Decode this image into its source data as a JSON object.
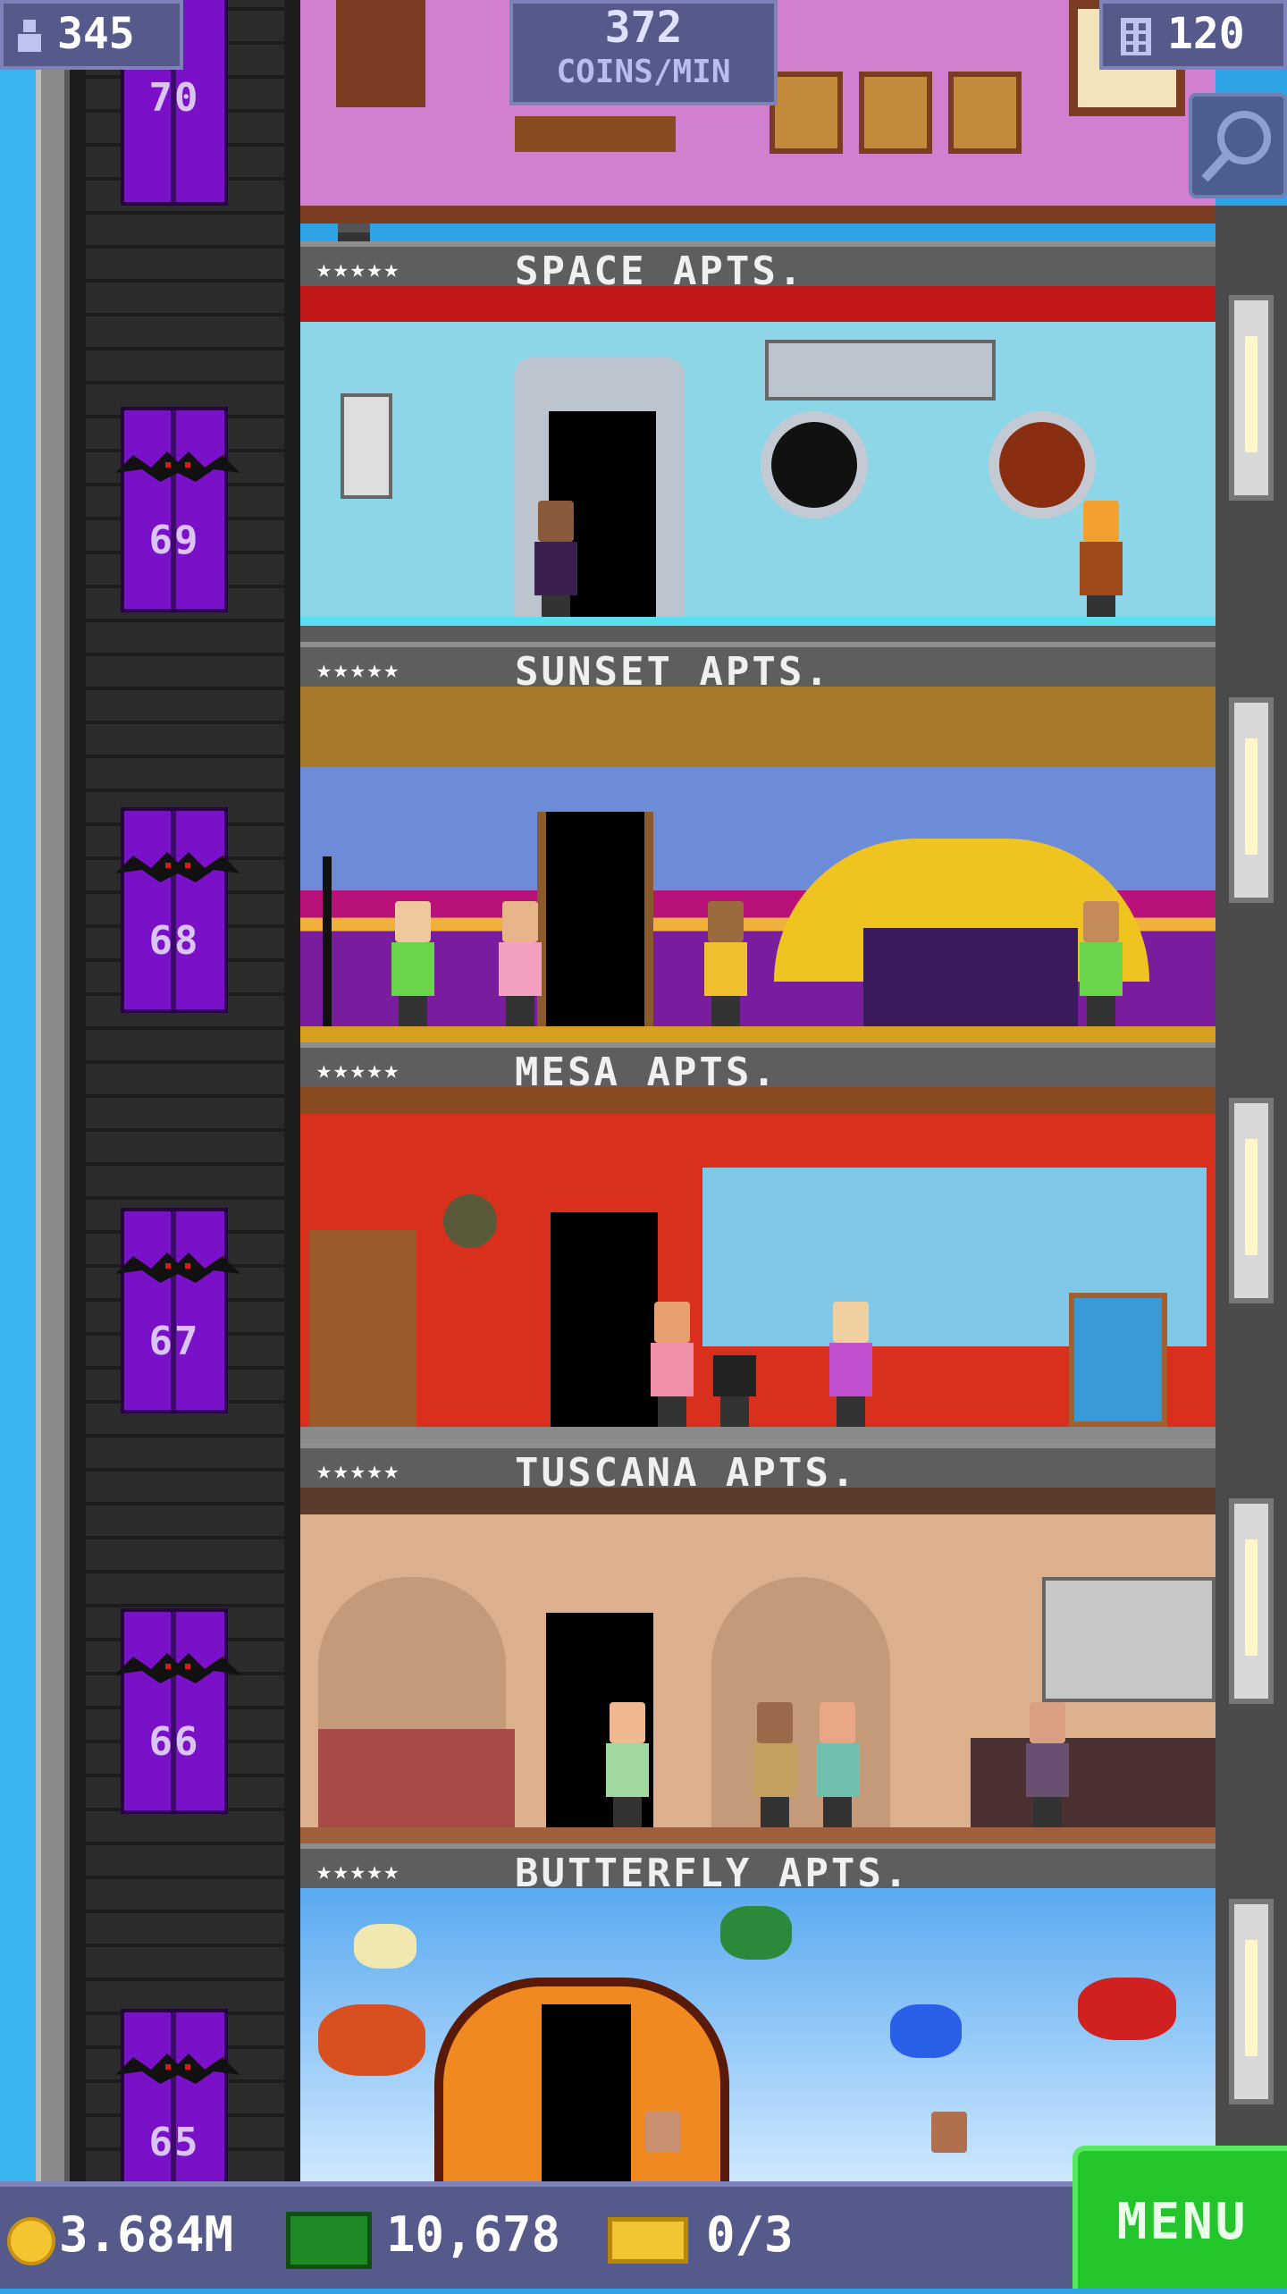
{
  "hud": {
    "population": "345",
    "coins_rate_value": "372",
    "coins_rate_unit": "COINS/MIN",
    "floor_count": "120",
    "search_icon": "magnifier-icon"
  },
  "floors": [
    {
      "number": "69",
      "name": "SPACE APTS.",
      "stars": "★★★★★",
      "theme": "space"
    },
    {
      "number": "68",
      "name": "SUNSET APTS.",
      "stars": "★★★★★",
      "theme": "sunset"
    },
    {
      "number": "67",
      "name": "MESA APTS.",
      "stars": "★★★★★",
      "theme": "mesa"
    },
    {
      "number": "66",
      "name": "TUSCANA APTS.",
      "stars": "★★★★★",
      "theme": "tuscana"
    },
    {
      "number": "65",
      "name": "BUTTERFLY APTS.",
      "stars": "★★★★★",
      "theme": "butterfly"
    }
  ],
  "top_elevator_number": "70",
  "bottom": {
    "coins": "3.684M",
    "bux": "10,678",
    "tickets": "0/3"
  },
  "menu_label": "MENU",
  "colors": {
    "hud_bg": "#555a8a",
    "elevator": "#7a10c8",
    "menu": "#22c52a"
  }
}
